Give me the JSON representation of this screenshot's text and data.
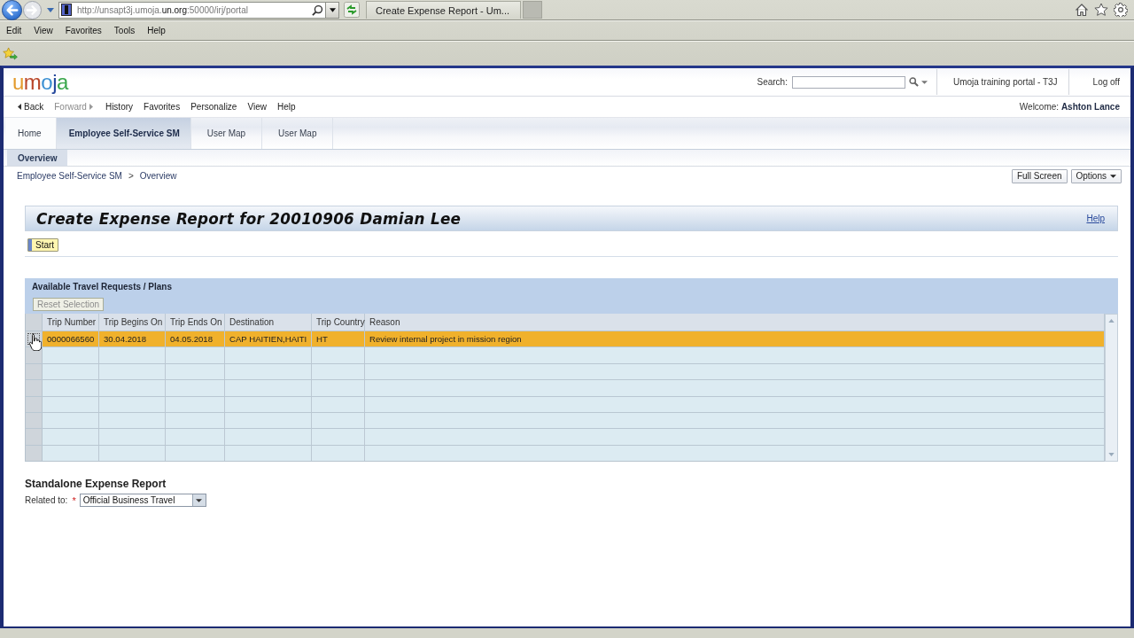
{
  "browser": {
    "address": "http://unsapt3j.umoja.**un.org**:50000/irj/portal",
    "tab_title": "Create Expense Report - Um...",
    "menu": [
      "Edit",
      "View",
      "Favorites",
      "Tools",
      "Help"
    ]
  },
  "header": {
    "logo": "umoja",
    "search_label": "Search:",
    "portal_name": "Umoja training portal - T3J",
    "logoff": "Log off"
  },
  "nav": [
    {
      "label": "Back",
      "kind": "back",
      "disabled": false
    },
    {
      "label": "Forward",
      "kind": "forward",
      "disabled": true
    },
    {
      "label": "History",
      "kind": "link",
      "disabled": false
    },
    {
      "label": "Favorites",
      "kind": "link",
      "disabled": false
    },
    {
      "label": "Personalize",
      "kind": "link",
      "disabled": false
    },
    {
      "label": "View",
      "kind": "link",
      "disabled": false
    },
    {
      "label": "Help",
      "kind": "link",
      "disabled": false
    }
  ],
  "welcome": {
    "label": "Welcome:",
    "user": "Ashton Lance"
  },
  "tabs": [
    {
      "label": "Home",
      "selected": false
    },
    {
      "label": "Employee Self-Service SM",
      "selected": true
    },
    {
      "label": "User Map",
      "selected": false
    },
    {
      "label": "User Map",
      "selected": false
    }
  ],
  "subtabs": [
    {
      "label": "Overview",
      "selected": true
    }
  ],
  "breadcrumb": {
    "items": [
      "Employee Self-Service SM",
      "Overview"
    ],
    "separator": ">"
  },
  "page_actions": [
    {
      "label": "Full Screen",
      "kind": "button"
    },
    {
      "label": "Options",
      "kind": "menu"
    }
  ],
  "page": {
    "title": "Create Expense Report for 20010906 Damian Lee",
    "help": "Help",
    "start": "Start"
  },
  "travel_table": {
    "title": "Available Travel Requests / Plans",
    "reset": {
      "label": "Reset Selection",
      "disabled": true
    },
    "columns": [
      "Trip Number",
      "Trip Begins On",
      "Trip Ends On",
      "Destination",
      "Trip Country",
      "Reason"
    ],
    "rows": [
      {
        "selected": true,
        "cells": [
          "0000066560",
          "30.04.2018",
          "04.05.2018",
          "CAP HAITIEN,HAITI",
          "HT",
          "Review internal project in mission region"
        ]
      }
    ]
  },
  "standalone": {
    "title": "Standalone Expense Report",
    "label": "Related to:",
    "required_marker": "*",
    "value": "Official Business Travel"
  }
}
